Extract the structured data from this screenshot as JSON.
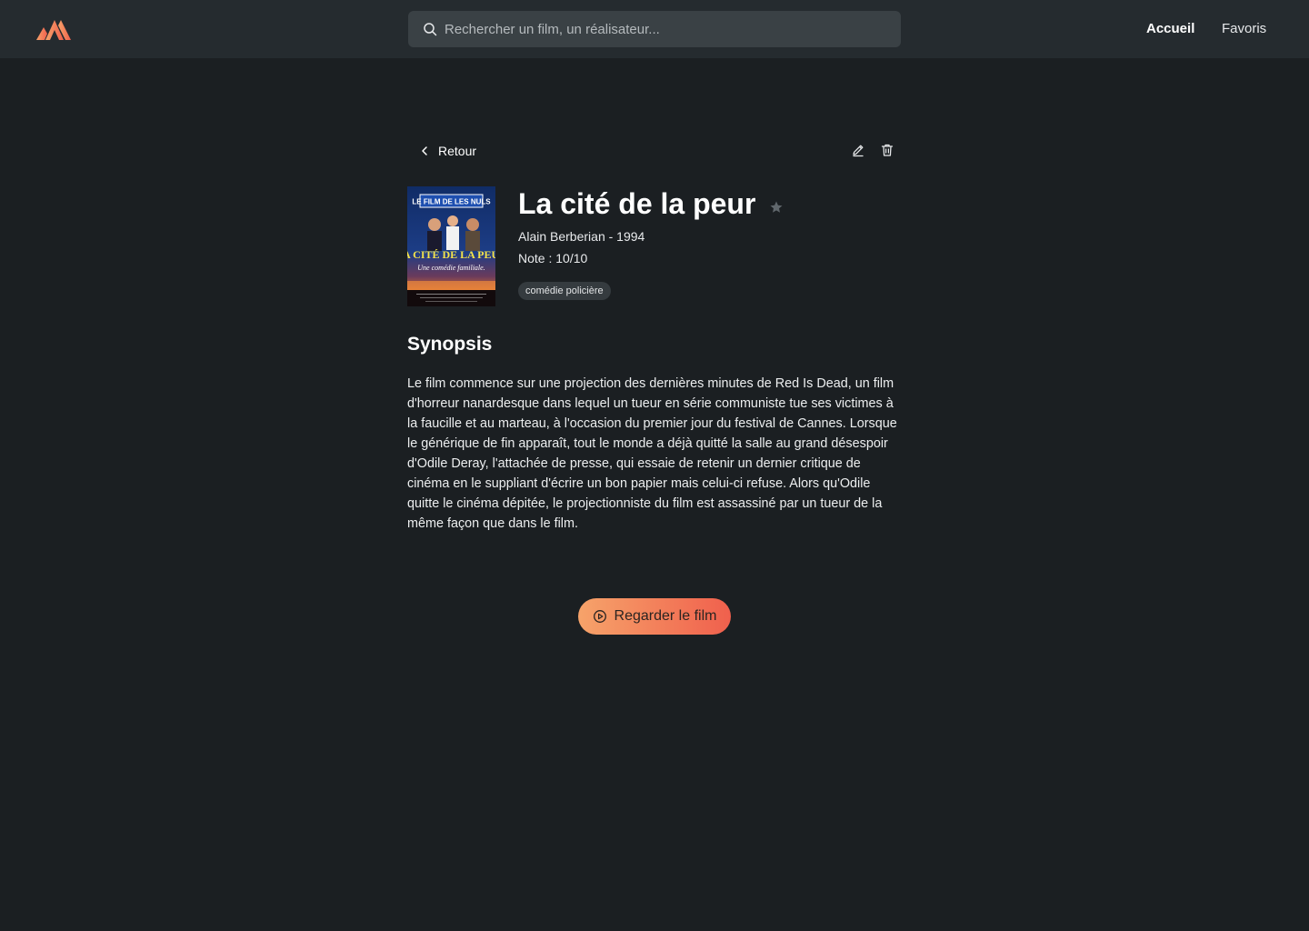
{
  "brand": {
    "logo_icon": "mountain-logo-icon",
    "colors": {
      "accent_start": "#f6a36a",
      "accent_end": "#f0604d",
      "background": "#1b1f22",
      "header": "#252b2f"
    }
  },
  "search": {
    "placeholder": "Rechercher un film, un réalisateur...",
    "icon": "search-icon"
  },
  "nav": {
    "home": "Accueil",
    "favorites": "Favoris"
  },
  "toolbar": {
    "back_label": "Retour",
    "back_icon": "chevron-left-icon",
    "edit_icon": "pencil-icon",
    "delete_icon": "trash-icon"
  },
  "movie": {
    "title": "La cité de la peur",
    "favorite_icon": "star-icon",
    "director_year": "Alain Berberian - 1994",
    "rating": "Note : 10/10",
    "genre": "comédie policière",
    "poster": {
      "top_caption": "LE FILM DE LES NULS",
      "title": "LA CITÉ DE LA PEUR",
      "tagline": "Une comédie familiale."
    }
  },
  "synopsis": {
    "heading": "Synopsis",
    "text": "Le film commence sur une projection des dernières minutes de Red Is Dead, un film d'horreur nanardesque dans lequel un tueur en série communiste tue ses victimes à la faucille et au marteau, à l'occasion du premier jour du festival de Cannes. Lorsque le générique de fin apparaît, tout le monde a déjà quitté la salle au grand désespoir d'Odile Deray, l'attachée de presse, qui essaie de retenir un dernier critique de cinéma en le suppliant d'écrire un bon papier mais celui-ci refuse. Alors qu'Odile quitte le cinéma dépitée, le projectionniste du film est assassiné par un tueur de la même façon que dans le film."
  },
  "watch": {
    "label": "Regarder le film",
    "icon": "play-circle-icon"
  }
}
